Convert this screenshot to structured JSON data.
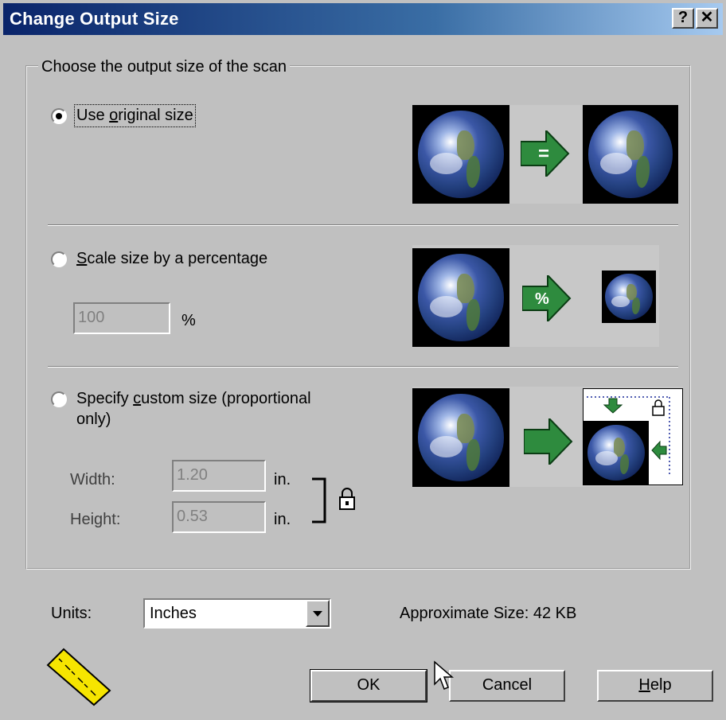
{
  "window": {
    "title": "Change Output Size",
    "help_button": "?",
    "close_button": "✕"
  },
  "group": {
    "legend": "Choose the output size of the scan"
  },
  "options": {
    "original": {
      "label_pre": "Use ",
      "label_key": "o",
      "label_post": "riginal size",
      "selected": true
    },
    "percentage": {
      "label_pre": "",
      "label_key": "S",
      "label_post": "cale size by a percentage",
      "selected": false,
      "value": "100",
      "unit": "%"
    },
    "custom": {
      "label_pre": "Specify ",
      "label_key": "c",
      "label_post": "ustom size (proportional",
      "label_line2": "only)",
      "selected": false,
      "width_label": "Width:",
      "width_value": "1.20",
      "width_unit": "in.",
      "height_label": "Height:",
      "height_value": "0.53",
      "height_unit": "in."
    }
  },
  "preview": {
    "original_arrow_symbol": "=",
    "percentage_arrow_symbol": "%"
  },
  "units": {
    "label": "Units:",
    "selected": "Inches"
  },
  "approximate_size": "Approximate Size: 42 KB",
  "buttons": {
    "ok": "OK",
    "cancel": "Cancel",
    "help_key": "H",
    "help_rest": "elp"
  },
  "colors": {
    "dialog_bg": "#c0c0c0",
    "titlebar_start": "#0a246a",
    "titlebar_end": "#a6caf0",
    "arrow_green": "#2e8b3e",
    "disabled_text": "#808080"
  },
  "icons": [
    "help-icon",
    "close-icon",
    "earth-icon",
    "lock-icon",
    "ruler-icon",
    "mouse-cursor-icon"
  ]
}
